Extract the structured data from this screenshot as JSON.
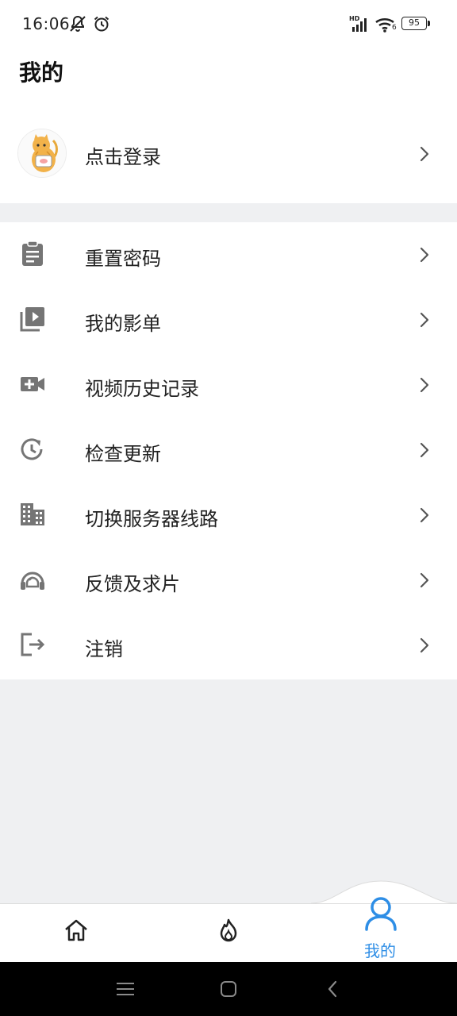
{
  "status_bar": {
    "time": "16:06",
    "network_badge": "HD",
    "wifi_badge": "6",
    "battery": "95"
  },
  "header": {
    "title": "我的",
    "login_label": "点击登录"
  },
  "menu": {
    "items": [
      {
        "label": "重置密码",
        "icon": "clipboard-icon"
      },
      {
        "label": "我的影单",
        "icon": "playlist-play-icon"
      },
      {
        "label": "视频历史记录",
        "icon": "video-camera-add-icon"
      },
      {
        "label": "检查更新",
        "icon": "update-clock-icon"
      },
      {
        "label": "切换服务器线路",
        "icon": "building-icon"
      },
      {
        "label": "反馈及求片",
        "icon": "headset-support-icon"
      },
      {
        "label": "注销",
        "icon": "logout-icon"
      }
    ]
  },
  "bottom_nav": {
    "active_label": "我的",
    "accent_color": "#2e8ee6"
  }
}
